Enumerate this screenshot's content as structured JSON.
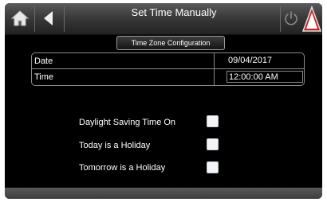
{
  "header": {
    "title": "Set Time Manually",
    "home_icon": "home-icon",
    "back_icon": "back-arrow-icon",
    "power_icon": "power-icon",
    "alarm_icon": "alarm-warning-icon",
    "alarm_color": "#cc1f1f"
  },
  "timezone_button": {
    "label": "Time Zone Configuration"
  },
  "table": {
    "rows": [
      {
        "label": "Date",
        "value": "09/04/2017"
      },
      {
        "label": "Time",
        "value": "12:00:00 AM"
      }
    ]
  },
  "options": [
    {
      "label": "Daylight Saving Time On",
      "checked": false
    },
    {
      "label": "Today is a Holiday",
      "checked": false
    },
    {
      "label": "Tomorrow is a Holiday",
      "checked": false
    }
  ]
}
